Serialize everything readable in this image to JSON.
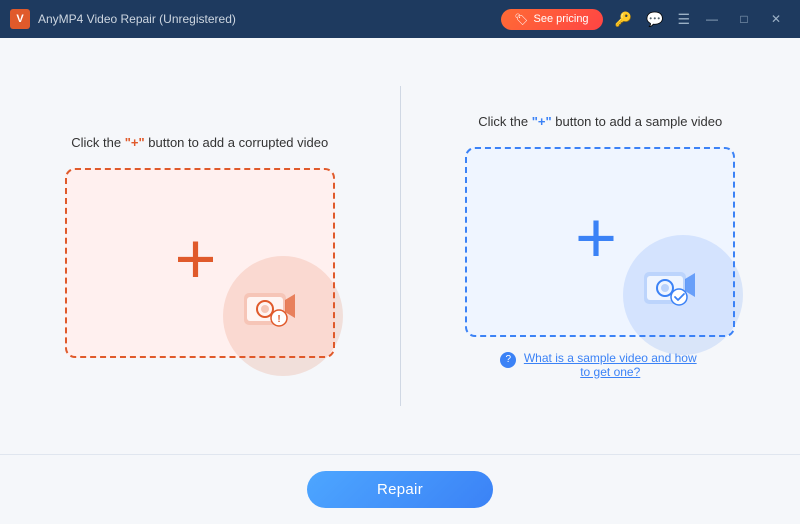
{
  "titlebar": {
    "logo_text": "V",
    "title": "AnyMP4 Video Repair (Unregistered)",
    "pricing_label": "See pricing",
    "pricing_icon": "🏷",
    "controls": {
      "minimize": "—",
      "maximize": "□",
      "close": "✕"
    },
    "icons": [
      "🔑",
      "💬",
      "☰"
    ]
  },
  "left_panel": {
    "instruction_prefix": "Click the ",
    "instruction_plus": "+",
    "instruction_suffix": " button to add a corrupted video",
    "dropzone_aria": "Add corrupted video drop zone"
  },
  "right_panel": {
    "instruction_prefix": "Click the ",
    "instruction_plus": "+",
    "instruction_suffix": " button to add a sample video",
    "dropzone_aria": "Add sample video drop zone",
    "help_text": "What is a sample video and how to get one?"
  },
  "footer": {
    "repair_label": "Repair"
  }
}
